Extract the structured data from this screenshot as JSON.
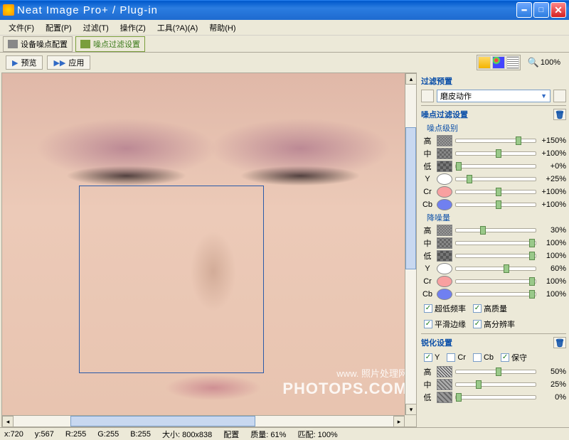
{
  "window": {
    "title": "Neat Image Pro+ / Plug-in"
  },
  "menu": {
    "file": "文件(F)",
    "config": "配置(P)",
    "filter": "过滤(T)",
    "action": "操作(Z)",
    "tools": "工具(?A)(A)",
    "help": "帮助(H)"
  },
  "tabs": {
    "device": "设备噪点配置",
    "filter": "噪点过滤设置"
  },
  "toolbar": {
    "preview": "预览",
    "apply": "应用",
    "zoom": "100%"
  },
  "preset": {
    "header": "过滤预置",
    "selected": "磨皮动作"
  },
  "noise_filter": {
    "header": "噪点过滤设置",
    "level_header": "噪点级别",
    "reduce_header": "降噪量",
    "labels": {
      "high": "高",
      "mid": "中",
      "low": "低",
      "y": "Y",
      "cr": "Cr",
      "cb": "Cb"
    },
    "level": {
      "high": "+150%",
      "mid": "+100%",
      "low": "+0%",
      "y": "+25%",
      "cr": "+100%",
      "cb": "+100%"
    },
    "reduce": {
      "high": "30%",
      "mid": "100%",
      "low": "100%",
      "y": "60%",
      "cr": "100%",
      "cb": "100%"
    },
    "level_pos": {
      "high": 75,
      "mid": 50,
      "low": 0,
      "y": 13,
      "cr": 50,
      "cb": 50
    },
    "reduce_pos": {
      "high": 30,
      "mid": 92,
      "low": 92,
      "y": 60,
      "cr": 92,
      "cb": 92
    }
  },
  "options": {
    "vlf": "超低频率",
    "hq": "高质量",
    "smooth": "平滑边缘",
    "hires": "高分辨率"
  },
  "sharpen": {
    "header": "锐化设置",
    "chk_y": "Y",
    "chk_cr": "Cr",
    "chk_cb": "Cb",
    "chk_keep": "保守",
    "high": "50%",
    "mid": "25%",
    "low": "0%",
    "pos": {
      "high": 50,
      "mid": 25,
      "low": 0
    }
  },
  "watermark": {
    "cn": "照片处理网",
    "en": "PHOTOPS.COM",
    "www": "www."
  },
  "status": {
    "x_lbl": "x:",
    "x": "720",
    "y_lbl": "y:",
    "y": "567",
    "r_lbl": "R:",
    "r": "255",
    "g_lbl": "G:",
    "g": "255",
    "b_lbl": "B:",
    "b": "255",
    "size_lbl": "大小:",
    "size": "800x838",
    "config_lbl": "配置",
    "quality_lbl": "质量:",
    "quality": "61%",
    "match_lbl": "匹配:",
    "match": "100%"
  }
}
